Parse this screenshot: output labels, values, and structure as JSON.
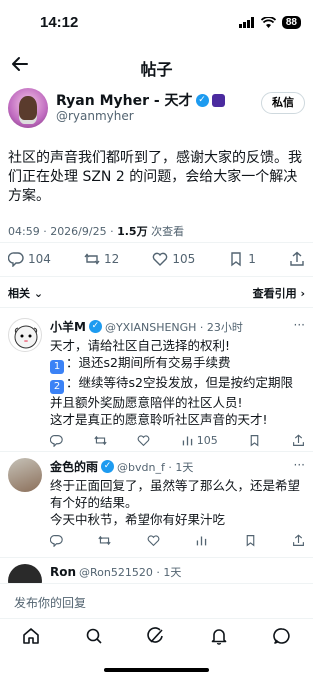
{
  "status_bar": {
    "time": "14:12",
    "battery": "88"
  },
  "nav": {
    "title": "帖子"
  },
  "post": {
    "author_name": "Ryan Myher - 天才",
    "author_handle": "@ryanmyher",
    "follow_label": "私信",
    "text": "社区的声音我们都听到了，感谢大家的反馈。我们正在处理 SZN 2 的问题，会给大家一个解决方案。",
    "time": "04:59 · 2026/9/25 · ",
    "views": "1.5万",
    "views_label": " 次查看",
    "replies": "104",
    "reposts": "12",
    "likes": "105",
    "bookmarks": "1"
  },
  "reply_bar": {
    "left": "相关",
    "right": "查看引用"
  },
  "replies": [
    {
      "name": "小羊M",
      "handle": "@YXIANSHENGH · 23小时",
      "lines": [
        "天才，请给社区自己选择的权利!",
        "1 退还s2期间所有交易手续费",
        "2 继续等待s2空投发放，但是按约定期限并且额外奖励愿意陪伴的社区人员!",
        "这才是真正的愿意聆听社区声音的天才!"
      ],
      "line1": "天才，请给社区自己选择的权利!",
      "badge1": "1",
      "line2": "退还s2期间所有交易手续费",
      "badge2": "2",
      "line3": "继续等待s2空投发放，但是按约定期限并且额外奖励愿意陪伴的社区人员!",
      "line4": "这才是真正的愿意聆听社区声音的天才!",
      "views": "105"
    },
    {
      "name": "金色的雨",
      "handle": "@bvdn_f · 1天",
      "line1": "终于正面回复了，虽然等了那么久，还是希望有个好的结果。",
      "line2": "今天中秋节，希望你有好果汁吃"
    },
    {
      "name": "Ron",
      "handle": "@Ron521520 · 1天"
    }
  ],
  "compose": {
    "placeholder": "发布你的回复"
  },
  "icons": [
    "back-arrow-icon",
    "home-icon",
    "search-icon",
    "grok-icon",
    "bell-icon",
    "mail-icon"
  ]
}
